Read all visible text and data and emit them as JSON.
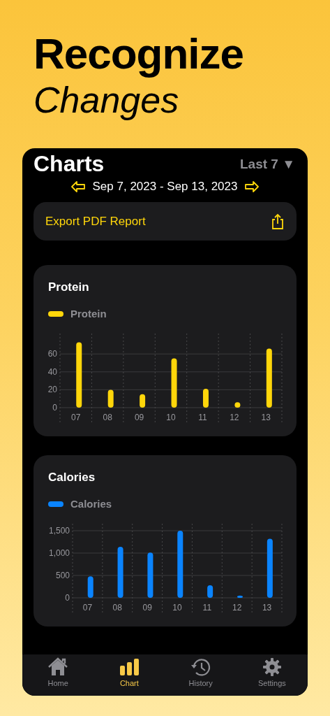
{
  "headline": {
    "line1": "Recognize",
    "line2": "Changes"
  },
  "screen": {
    "title": "Charts",
    "range_picker": {
      "label": "Last 7",
      "caret": "▼"
    },
    "date_range": "Sep 7, 2023 - Sep 13, 2023",
    "export_button": "Export PDF Report",
    "charts": [
      {
        "title": "Protein",
        "chart_data": {
          "type": "bar",
          "grid": true,
          "categories": [
            "07",
            "08",
            "09",
            "10",
            "11",
            "12",
            "13"
          ],
          "series": [
            {
              "name": "Protein",
              "color": "#ffd60a",
              "values": [
                73,
                20,
                15,
                55,
                21,
                6,
                66
              ]
            }
          ],
          "ylim": [
            0,
            75
          ],
          "yticks": [
            0,
            20,
            40,
            60
          ]
        }
      },
      {
        "title": "Calories",
        "chart_data": {
          "type": "bar",
          "grid": true,
          "categories": [
            "07",
            "08",
            "09",
            "10",
            "11",
            "12",
            "13"
          ],
          "series": [
            {
              "name": "Calories",
              "color": "#0a84ff",
              "values": [
                480,
                1140,
                1010,
                1500,
                280,
                50,
                1320
              ]
            }
          ],
          "ylim": [
            0,
            1500
          ],
          "yticks": [
            {
              "value": 0,
              "label": "0"
            },
            {
              "value": 500,
              "label": "500"
            },
            {
              "value": 1000,
              "label": "1,000"
            },
            {
              "value": 1500,
              "label": "1,500"
            }
          ]
        }
      }
    ],
    "tabs": [
      {
        "label": "Home",
        "selected": false
      },
      {
        "label": "Chart",
        "selected": true
      },
      {
        "label": "History",
        "selected": false
      },
      {
        "label": "Settings",
        "selected": false
      }
    ]
  }
}
